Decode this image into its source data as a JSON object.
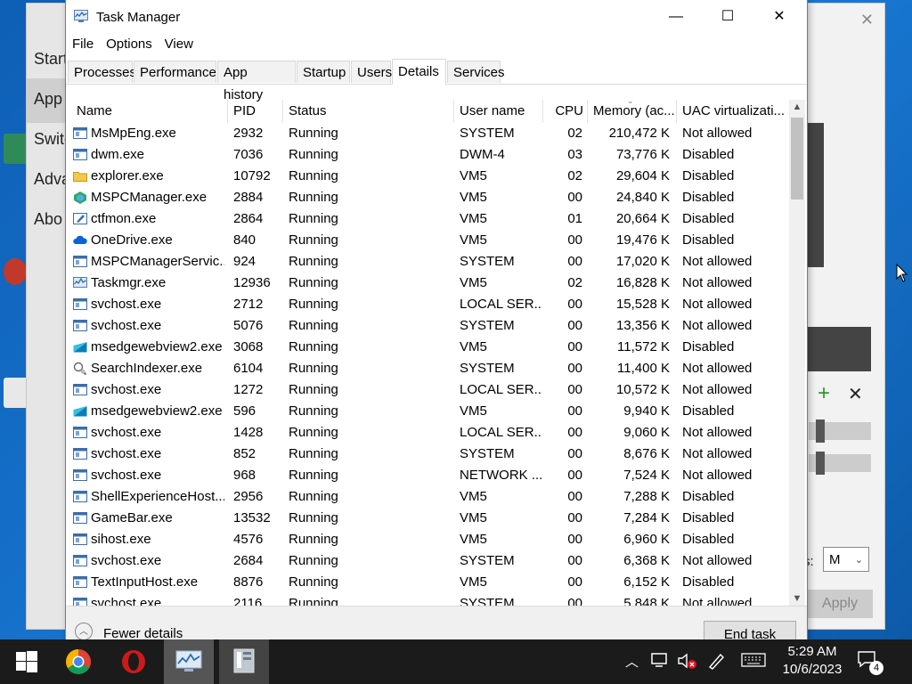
{
  "desktop": {
    "settings_window": {
      "sidebar": [
        "Start",
        "App",
        "Switc",
        "Adva",
        "Abo"
      ],
      "s_label": "s:",
      "select_value": "M",
      "apply_label": "Apply"
    }
  },
  "window": {
    "title": "Task Manager",
    "menu": [
      "File",
      "Options",
      "View"
    ],
    "tabs": [
      "Processes",
      "Performance",
      "App history",
      "Startup",
      "Users",
      "Details",
      "Services"
    ],
    "active_tab": "Details"
  },
  "columns": [
    "Name",
    "PID",
    "Status",
    "User name",
    "CPU",
    "Memory (ac...",
    "UAC virtualizati..."
  ],
  "processes": [
    {
      "icon": "app-icon",
      "name": "MsMpEng.exe",
      "pid": "2932",
      "status": "Running",
      "user": "SYSTEM",
      "cpu": "02",
      "memory": "210,472 K",
      "uac": "Not allowed"
    },
    {
      "icon": "app-icon",
      "name": "dwm.exe",
      "pid": "7036",
      "status": "Running",
      "user": "DWM-4",
      "cpu": "03",
      "memory": "73,776 K",
      "uac": "Disabled"
    },
    {
      "icon": "folder-icon",
      "name": "explorer.exe",
      "pid": "10792",
      "status": "Running",
      "user": "VM5",
      "cpu": "02",
      "memory": "29,604 K",
      "uac": "Disabled"
    },
    {
      "icon": "pcmanager-icon",
      "name": "MSPCManager.exe",
      "pid": "2884",
      "status": "Running",
      "user": "VM5",
      "cpu": "00",
      "memory": "24,840 K",
      "uac": "Disabled"
    },
    {
      "icon": "pen-icon",
      "name": "ctfmon.exe",
      "pid": "2864",
      "status": "Running",
      "user": "VM5",
      "cpu": "01",
      "memory": "20,664 K",
      "uac": "Disabled"
    },
    {
      "icon": "cloud-icon",
      "name": "OneDrive.exe",
      "pid": "840",
      "status": "Running",
      "user": "VM5",
      "cpu": "00",
      "memory": "19,476 K",
      "uac": "Disabled"
    },
    {
      "icon": "app-icon",
      "name": "MSPCManagerServic...",
      "pid": "924",
      "status": "Running",
      "user": "SYSTEM",
      "cpu": "00",
      "memory": "17,020 K",
      "uac": "Not allowed"
    },
    {
      "icon": "taskmgr-icon",
      "name": "Taskmgr.exe",
      "pid": "12936",
      "status": "Running",
      "user": "VM5",
      "cpu": "02",
      "memory": "16,828 K",
      "uac": "Not allowed"
    },
    {
      "icon": "app-icon",
      "name": "svchost.exe",
      "pid": "2712",
      "status": "Running",
      "user": "LOCAL SER...",
      "cpu": "00",
      "memory": "15,528 K",
      "uac": "Not allowed"
    },
    {
      "icon": "app-icon",
      "name": "svchost.exe",
      "pid": "5076",
      "status": "Running",
      "user": "SYSTEM",
      "cpu": "00",
      "memory": "13,356 K",
      "uac": "Not allowed"
    },
    {
      "icon": "webview-icon",
      "name": "msedgewebview2.exe",
      "pid": "3068",
      "status": "Running",
      "user": "VM5",
      "cpu": "00",
      "memory": "11,572 K",
      "uac": "Disabled"
    },
    {
      "icon": "search-indexer-icon",
      "name": "SearchIndexer.exe",
      "pid": "6104",
      "status": "Running",
      "user": "SYSTEM",
      "cpu": "00",
      "memory": "11,400 K",
      "uac": "Not allowed"
    },
    {
      "icon": "app-icon",
      "name": "svchost.exe",
      "pid": "1272",
      "status": "Running",
      "user": "LOCAL SER...",
      "cpu": "00",
      "memory": "10,572 K",
      "uac": "Not allowed"
    },
    {
      "icon": "webview-icon",
      "name": "msedgewebview2.exe",
      "pid": "596",
      "status": "Running",
      "user": "VM5",
      "cpu": "00",
      "memory": "9,940 K",
      "uac": "Disabled"
    },
    {
      "icon": "app-icon",
      "name": "svchost.exe",
      "pid": "1428",
      "status": "Running",
      "user": "LOCAL SER...",
      "cpu": "00",
      "memory": "9,060 K",
      "uac": "Not allowed"
    },
    {
      "icon": "app-icon",
      "name": "svchost.exe",
      "pid": "852",
      "status": "Running",
      "user": "SYSTEM",
      "cpu": "00",
      "memory": "8,676 K",
      "uac": "Not allowed"
    },
    {
      "icon": "app-icon",
      "name": "svchost.exe",
      "pid": "968",
      "status": "Running",
      "user": "NETWORK ...",
      "cpu": "00",
      "memory": "7,524 K",
      "uac": "Not allowed"
    },
    {
      "icon": "app-icon",
      "name": "ShellExperienceHost....",
      "pid": "2956",
      "status": "Running",
      "user": "VM5",
      "cpu": "00",
      "memory": "7,288 K",
      "uac": "Disabled"
    },
    {
      "icon": "app-icon",
      "name": "GameBar.exe",
      "pid": "13532",
      "status": "Running",
      "user": "VM5",
      "cpu": "00",
      "memory": "7,284 K",
      "uac": "Disabled"
    },
    {
      "icon": "app-icon",
      "name": "sihost.exe",
      "pid": "4576",
      "status": "Running",
      "user": "VM5",
      "cpu": "00",
      "memory": "6,960 K",
      "uac": "Disabled"
    },
    {
      "icon": "app-icon",
      "name": "svchost.exe",
      "pid": "2684",
      "status": "Running",
      "user": "SYSTEM",
      "cpu": "00",
      "memory": "6,368 K",
      "uac": "Not allowed"
    },
    {
      "icon": "app-icon",
      "name": "TextInputHost.exe",
      "pid": "8876",
      "status": "Running",
      "user": "VM5",
      "cpu": "00",
      "memory": "6,152 K",
      "uac": "Disabled"
    },
    {
      "icon": "app-icon",
      "name": "svchost.exe",
      "pid": "2116",
      "status": "Running",
      "user": "SYSTEM",
      "cpu": "00",
      "memory": "5,848 K",
      "uac": "Not allowed"
    }
  ],
  "footer": {
    "fewer_details": "Fewer details",
    "end_task": "End task"
  },
  "taskbar": {
    "apps": [
      "windows-start-icon",
      "chrome-icon",
      "opera-icon",
      "task-manager-icon",
      "settings-app-icon"
    ],
    "time": "5:29 AM",
    "date": "10/6/2023",
    "notification_count": "4"
  },
  "colors": {
    "desktop": "#1573c9",
    "taskbar": "#1b1b1b",
    "selected_taskbar": "#555555"
  }
}
